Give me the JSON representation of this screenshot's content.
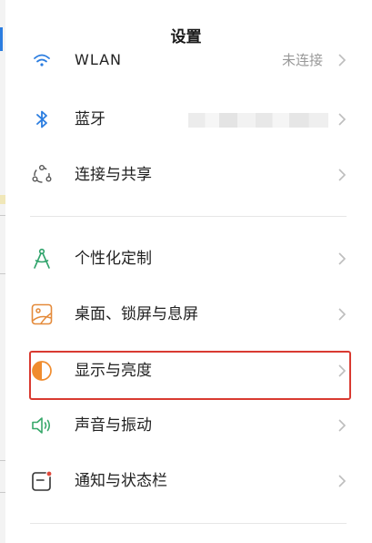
{
  "header": {
    "title": "设置"
  },
  "settings": {
    "wlan": {
      "label": "WLAN",
      "value": "未连接"
    },
    "bluetooth": {
      "label": "蓝牙"
    },
    "sharing": {
      "label": "连接与共享"
    },
    "personalize": {
      "label": "个性化定制"
    },
    "wallpaper": {
      "label": "桌面、锁屏与息屏"
    },
    "display": {
      "label": "显示与亮度"
    },
    "sound": {
      "label": "声音与振动"
    },
    "notifications": {
      "label": "通知与状态栏"
    }
  },
  "icons": {
    "wlan": "wifi-icon",
    "bluetooth": "bluetooth-icon",
    "sharing": "connection-share-icon",
    "personalize": "compass-icon",
    "wallpaper": "wallpaper-icon",
    "display": "brightness-icon",
    "sound": "speaker-icon",
    "notifications": "notification-icon",
    "chevron": "chevron-right-icon"
  },
  "colors": {
    "accent_blue": "#2b7de0",
    "personalize_green": "#2fa36b",
    "wallpaper_orange": "#e48a3a",
    "display_orange": "#f08c2e",
    "sound_green": "#37a86a",
    "notification_red": "#e0493c",
    "highlight_red": "#d93a31",
    "chevron": "#bdbdbd"
  }
}
